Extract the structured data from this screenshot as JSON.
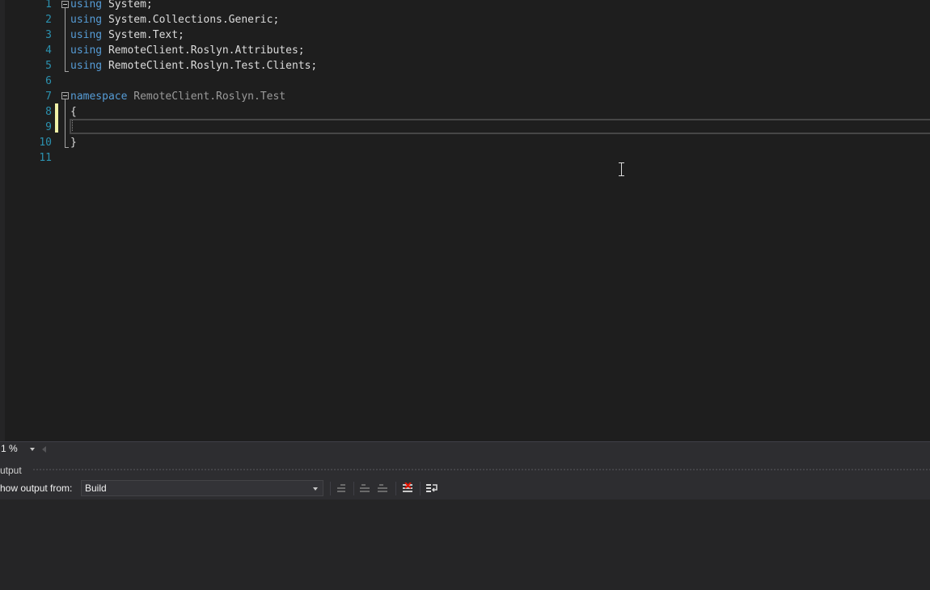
{
  "editor": {
    "line_numbers": [
      "1",
      "2",
      "3",
      "4",
      "5",
      "6",
      "7",
      "8",
      "9",
      "10",
      "11"
    ],
    "lines": [
      [
        {
          "kw": "using"
        },
        {
          "t": " System;"
        }
      ],
      [
        {
          "kw": "using"
        },
        {
          "t": " System.Collections.Generic;"
        }
      ],
      [
        {
          "kw": "using"
        },
        {
          "t": " System.Text;"
        }
      ],
      [
        {
          "kw": "using"
        },
        {
          "t": " RemoteClient.Roslyn.Attributes;"
        }
      ],
      [
        {
          "kw": "using"
        },
        {
          "t": " RemoteClient.Roslyn.Test.Clients;"
        }
      ],
      [],
      [
        {
          "kw": "namespace"
        },
        {
          "ns": " RemoteClient.Roslyn.Test"
        }
      ],
      [
        {
          "t": "{"
        }
      ],
      [],
      [
        {
          "t": "}"
        }
      ],
      []
    ],
    "current_line": 9
  },
  "statusbar": {
    "zoom": "1 %"
  },
  "output": {
    "title": "utput",
    "show_from_label": "how output from:",
    "source_selected": "Build"
  },
  "colors": {
    "keyword": "#569cd6",
    "line_number": "#2b91af",
    "namespace": "#9b9b9b",
    "change_marker": "#eff0a6"
  }
}
